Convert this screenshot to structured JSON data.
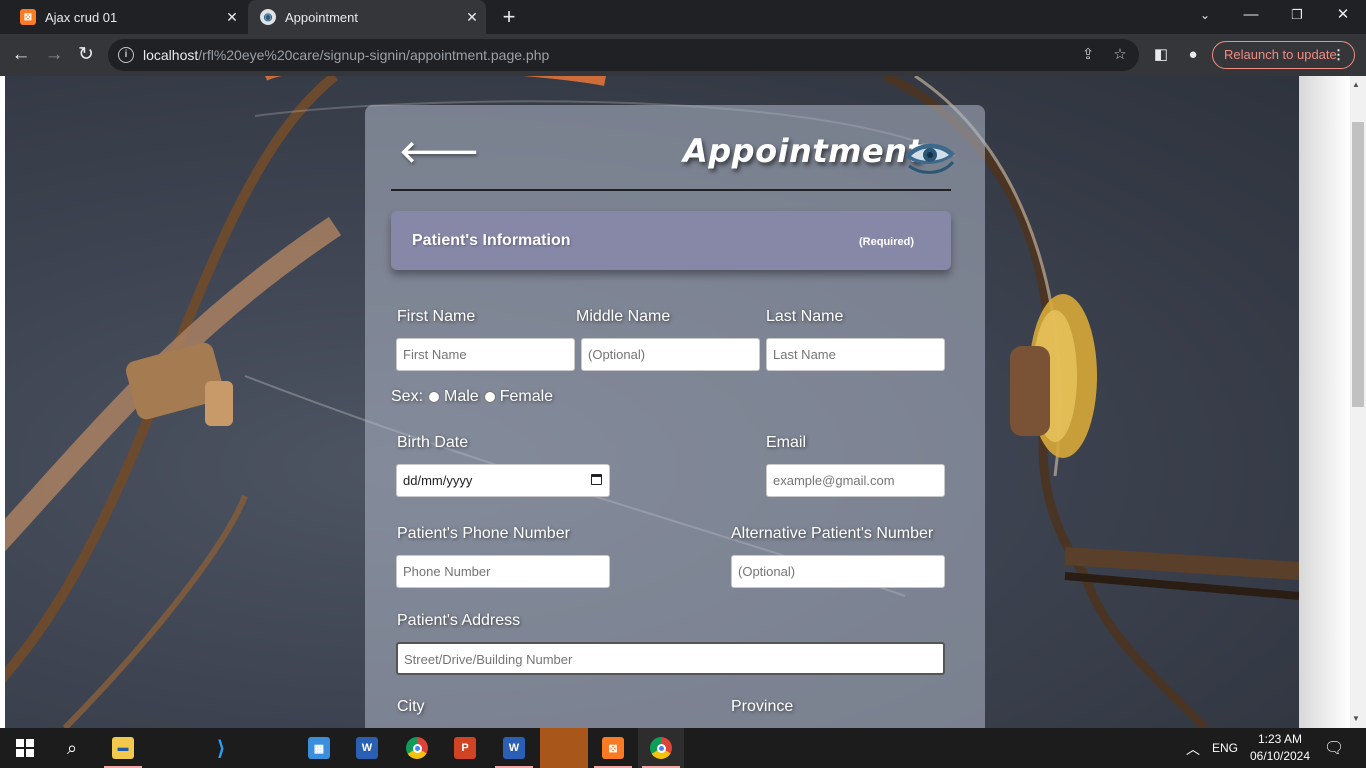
{
  "browser": {
    "tabs": [
      {
        "title": "Ajax crud 01",
        "favicon": "xampp-icon",
        "active": false
      },
      {
        "title": "Appointment",
        "favicon": "eye-care-icon",
        "active": true
      }
    ],
    "url_host": "localhost",
    "url_path": "/rfl%20eye%20care/signup-signin/appointment.page.php",
    "relaunch_label": "Relaunch to update"
  },
  "form": {
    "title": "Appointment",
    "section_title": "Patient's Information",
    "section_note": "(Required)",
    "labels": {
      "first_name": "First Name",
      "middle_name": "Middle Name",
      "last_name": "Last Name",
      "sex": "Sex:",
      "male": "Male",
      "female": "Female",
      "birth_date": "Birth Date",
      "email": "Email",
      "phone": "Patient's Phone Number",
      "alt_phone": "Alternative Patient's Number",
      "address": "Patient's Address",
      "city": "City",
      "province": "Province"
    },
    "placeholders": {
      "first_name": "First Name",
      "middle_name": "(Optional)",
      "last_name": "Last Name",
      "birth_date": "dd/mm/yyyy",
      "email": "example@gmail.com",
      "phone": "Phone Number",
      "alt_phone": "(Optional)",
      "address": "Street/Drive/Building Number"
    }
  },
  "taskbar": {
    "time": "1:23 AM",
    "date": "06/10/2024",
    "language": "ENG"
  },
  "colors": {
    "section_header": "#8787a8",
    "relaunch": "#f28b82",
    "chrome_bg": "#202124"
  }
}
